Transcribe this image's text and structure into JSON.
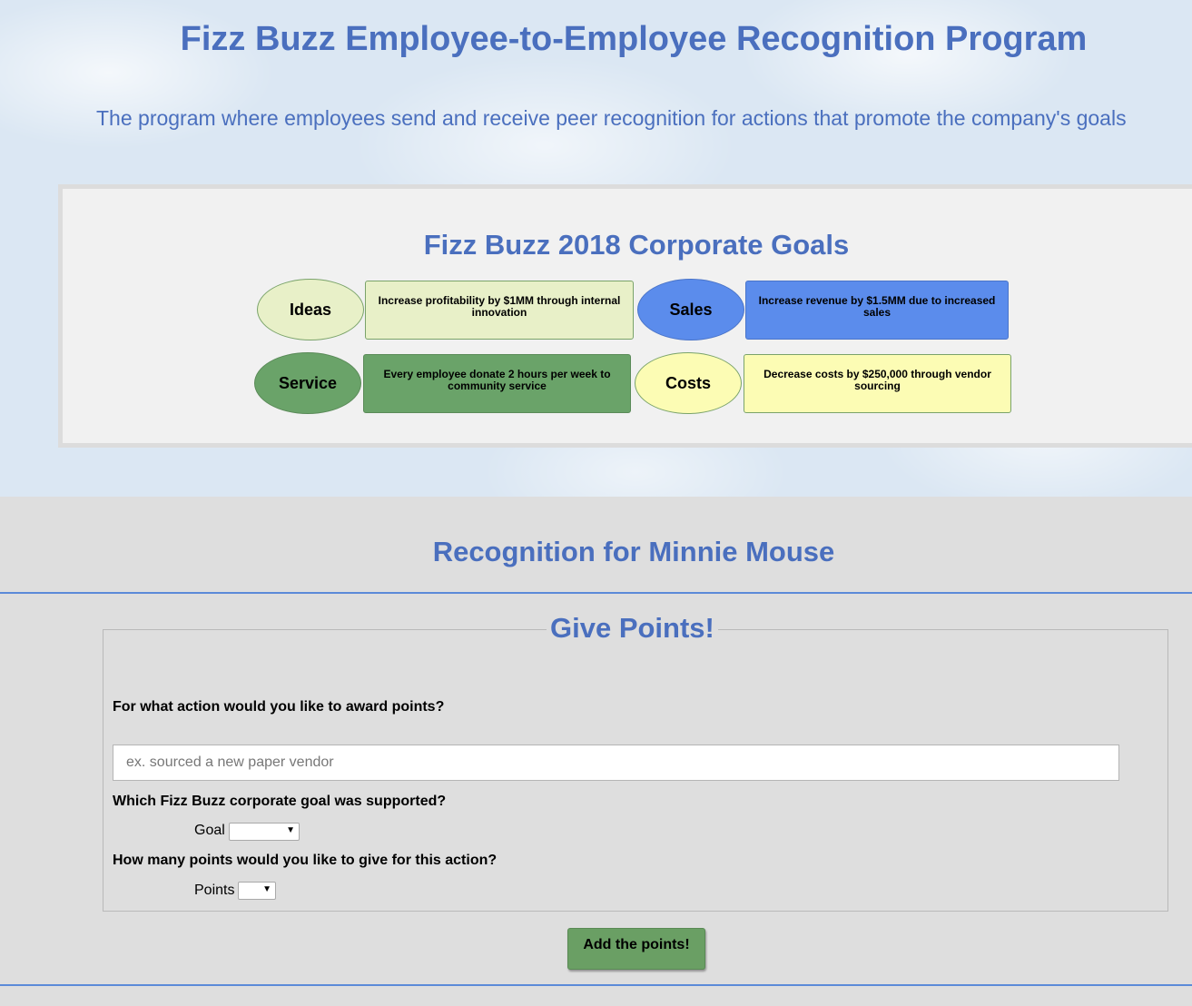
{
  "header": {
    "title": "Fizz Buzz Employee-to-Employee Recognition Program",
    "subtitle": "The program where employees send and receive peer recognition for actions that promote the company's goals"
  },
  "goals": {
    "title": "Fizz Buzz 2018 Corporate Goals",
    "items": [
      {
        "name": "Ideas",
        "description": "Increase profitability by $1MM through internal innovation",
        "color": "#e8f0c8"
      },
      {
        "name": "Sales",
        "description": "Increase revenue by $1.5MM due to increased sales",
        "color": "#5b8cec"
      },
      {
        "name": "Service",
        "description": "Every employee donate 2 hours per week to community service",
        "color": "#6aa369"
      },
      {
        "name": "Costs",
        "description": "Decrease costs by $250,000 through vendor sourcing",
        "color": "#fcfcb4"
      }
    ]
  },
  "recognition": {
    "title": "Recognition for Minnie Mouse"
  },
  "form": {
    "legend": "Give Points!",
    "action_question": "For what action would you like to award points?",
    "action_placeholder": "ex. sourced a new paper vendor",
    "action_value": "",
    "goal_question": "Which Fizz Buzz corporate goal was supported?",
    "goal_label": "Goal",
    "goal_selected": "",
    "points_question": "How many points would you like to give for this action?",
    "points_label": "Points",
    "points_selected": "",
    "submit_label": "Add the points!"
  },
  "icons": {
    "select_arrow": "chevron-down-icon"
  },
  "colors": {
    "heading": "#4a6fbe",
    "divider": "#5b8ad8",
    "button": "#6a9f64"
  }
}
